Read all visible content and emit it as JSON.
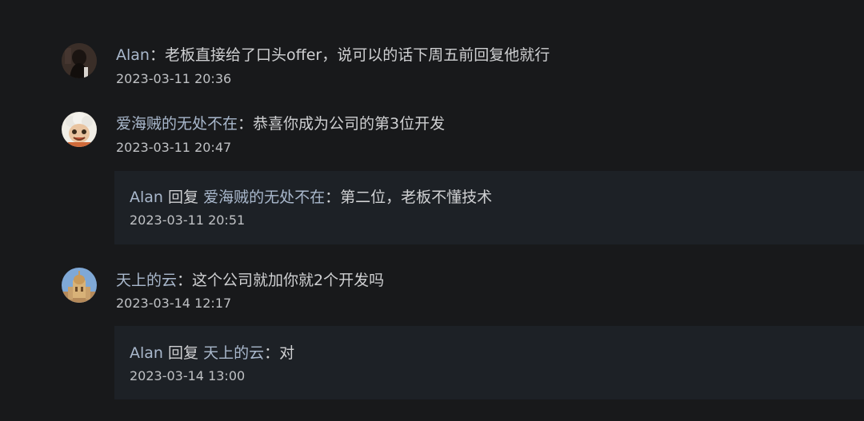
{
  "comments": [
    {
      "author": "Alan",
      "separator": "：",
      "text": "老板直接给了口头offer，说可以的话下周五前回复他就行",
      "time": "2023-03-11 20:36"
    },
    {
      "author": "爱海贼的无处不在",
      "separator": "：",
      "text": "恭喜你成为公司的第3位开发",
      "time": "2023-03-11 20:47",
      "reply": {
        "author": "Alan",
        "reply_word": "回复",
        "target": "爱海贼的无处不在",
        "separator": "：",
        "text": "第二位，老板不懂技术",
        "time": "2023-03-11 20:51"
      }
    },
    {
      "author": "天上的云",
      "separator": "：",
      "text": "这个公司就加你就2个开发吗",
      "time": "2023-03-14 12:17",
      "reply": {
        "author": "Alan",
        "reply_word": "回复",
        "target": "天上的云",
        "separator": "：",
        "text": "对",
        "time": "2023-03-14 13:00"
      }
    }
  ],
  "colors": {
    "background": "#18191b",
    "reply_background": "#1d2126",
    "name": "#a9b8cc",
    "text": "#cfd0d2"
  }
}
